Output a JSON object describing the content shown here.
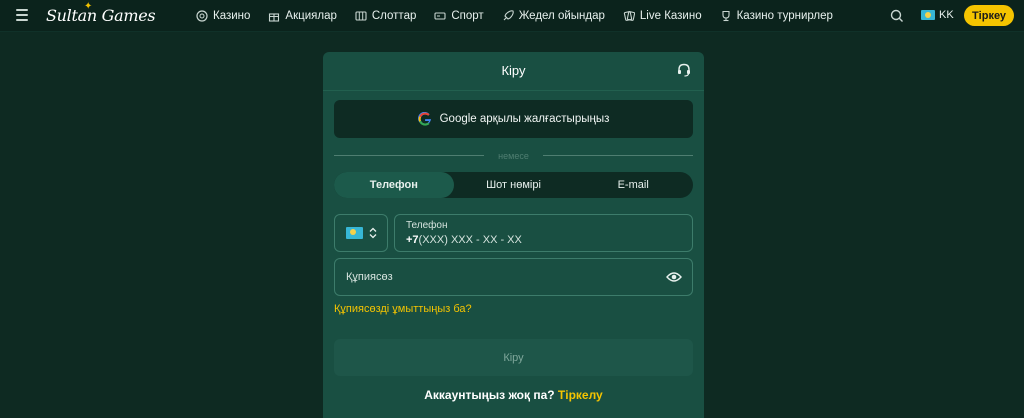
{
  "header": {
    "logo_text": "Sultan Games",
    "nav": [
      {
        "label": "Казино",
        "icon": "casino-chip-icon"
      },
      {
        "label": "Акциялар",
        "icon": "gift-icon"
      },
      {
        "label": "Слоттар",
        "icon": "slot-machine-icon"
      },
      {
        "label": "Спорт",
        "icon": "ticket-icon"
      },
      {
        "label": "Жедел ойындар",
        "icon": "rocket-icon"
      },
      {
        "label": "Live Казино",
        "icon": "live-cards-icon"
      },
      {
        "label": "Казино турнирлер",
        "icon": "trophy-icon"
      }
    ],
    "language": "KK",
    "register_label": "Тіркеу"
  },
  "modal": {
    "title": "Кіру",
    "google_label": "Google арқылы жалғастырыңыз",
    "or_text": "немесе",
    "tabs": [
      {
        "label": "Телефон",
        "active": true
      },
      {
        "label": "Шот нөмірі",
        "active": false
      },
      {
        "label": "E-mail",
        "active": false
      }
    ],
    "phone": {
      "label": "Телефон",
      "prefix": "+7",
      "mask": "(XXX) XXX - XX - XX"
    },
    "password_placeholder": "Құпиясөз",
    "forgot_link": "Құпиясөзді ұмыттыңыз ба?",
    "submit_label": "Кіру",
    "no_account_text": "Аккаунтыңыз жоқ па?",
    "signup_link": "Тіркелу"
  },
  "colors": {
    "background": "#0e2a22",
    "modal": "#194f42",
    "accent": "#f5c400"
  }
}
